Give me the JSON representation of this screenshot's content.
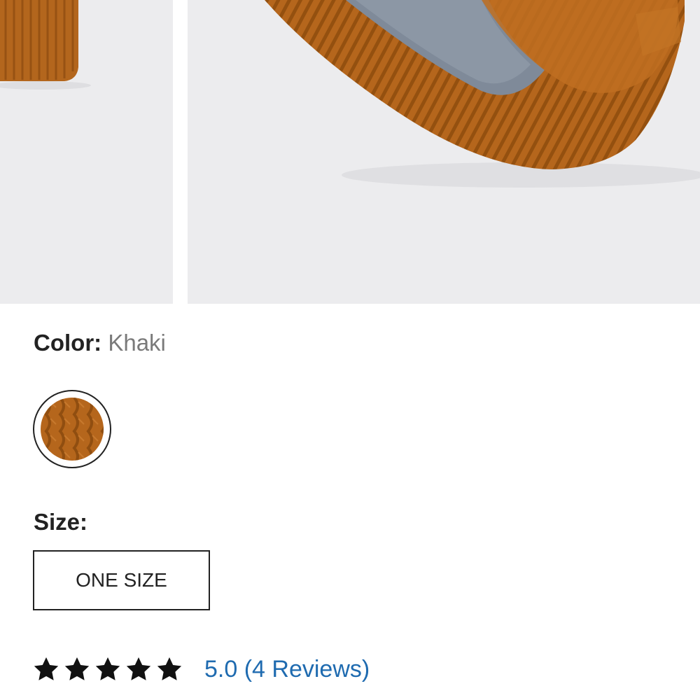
{
  "gallery": {
    "images": [
      {
        "name": "product-thumbnail-1",
        "subject": "knit-hat-ribbed-cuff"
      },
      {
        "name": "product-thumbnail-2",
        "subject": "knit-hat-fleece-lining"
      }
    ]
  },
  "color": {
    "label": "Color:",
    "value": "Khaki",
    "swatch_color": "#b5661c"
  },
  "size": {
    "label": "Size:",
    "options": [
      "ONE SIZE"
    ]
  },
  "rating": {
    "stars_filled": 5,
    "stars_total": 5,
    "summary": "5.0 (4 Reviews)",
    "star_icon": "star-icon"
  },
  "colors": {
    "text": "#222222",
    "muted": "#7a7a7a",
    "link": "#1f6bb0",
    "knit": "#b5661c"
  }
}
